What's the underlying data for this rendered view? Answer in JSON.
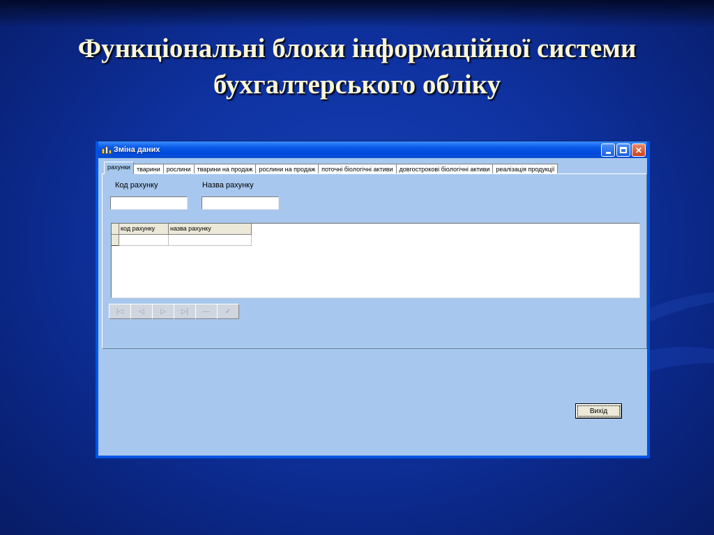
{
  "slide": {
    "title_line1": "Функціональні блоки інформаційної системи",
    "title_line2": "бухгалтерського обліку"
  },
  "window": {
    "title": "Зміна даних",
    "icon": "app-icon",
    "controls": [
      "minimize-icon",
      "maximize-icon",
      "close-icon"
    ]
  },
  "tabs": [
    "рахунки",
    "тварини",
    "рослини",
    "тварини на продаж",
    "рослини на продаж",
    "поточні біологічні активи",
    "довгострокові біологічні активи",
    "реалізація продукції"
  ],
  "active_tab": "рахунки",
  "form": {
    "code_label": "Код рахунку",
    "code_value": "",
    "name_label": "Назва рахунку",
    "name_value": ""
  },
  "grid": {
    "columns": [
      "код рахунку",
      "назва рахунку"
    ],
    "rows": [
      [
        "",
        ""
      ]
    ]
  },
  "navigator": [
    "first-icon",
    "prior-icon",
    "next-icon",
    "last-icon",
    "delete-icon",
    "post-icon"
  ],
  "exit_label": "Вихід",
  "colors": {
    "slide_bg": "#0f32a0",
    "title_text": "#fbf6d4",
    "window_bg": "#a7c7ee",
    "titlebar": "#0048dc"
  }
}
